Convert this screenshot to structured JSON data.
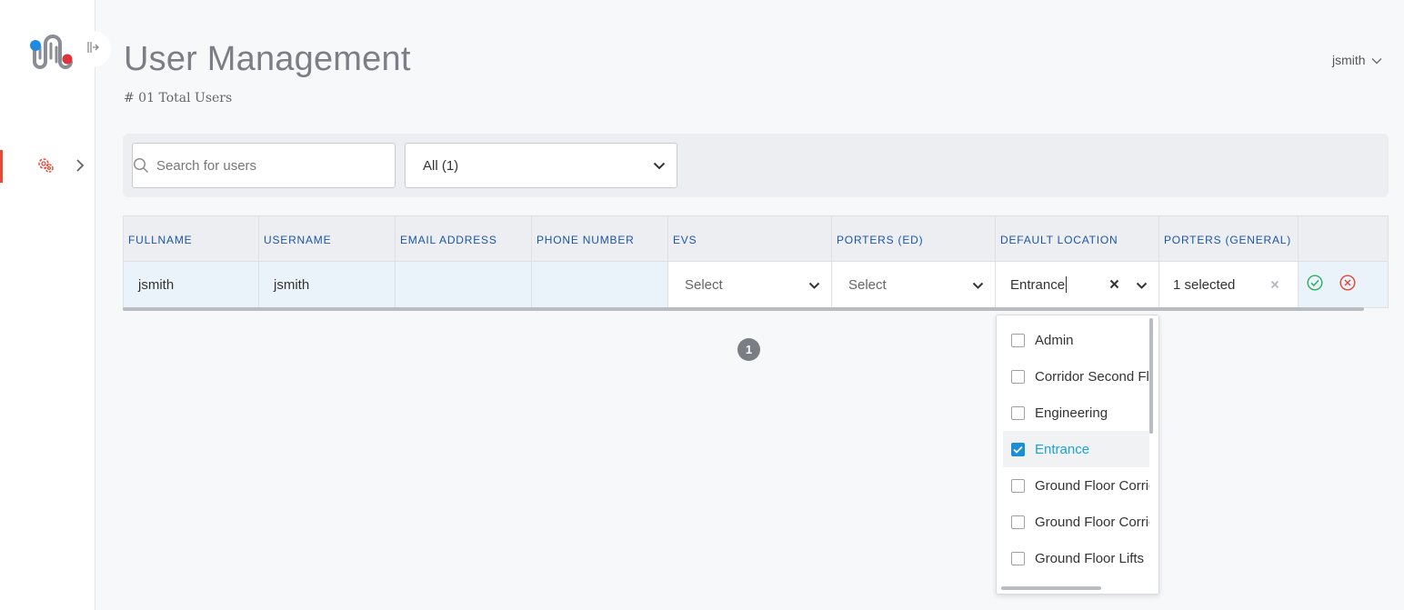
{
  "header": {
    "title": "User Management",
    "subtitle": "# 01 Total Users",
    "username": "jsmith"
  },
  "filters": {
    "search_placeholder": "Search for users",
    "role_filter_value": "All (1)"
  },
  "table": {
    "columns": [
      "FULLNAME",
      "USERNAME",
      "EMAIL ADDRESS",
      "PHONE NUMBER",
      "EVS",
      "PORTERS (ED)",
      "DEFAULT LOCATION",
      "PORTERS (GENERAL)"
    ],
    "row": {
      "fullname": "jsmith",
      "username": "jsmith",
      "email": "",
      "phone": "",
      "evs": "Select",
      "porters_ed": "Select",
      "default_location": "Entrance",
      "porters_general": "1 selected"
    }
  },
  "pagination": {
    "current_page": "1"
  },
  "location_dropdown": {
    "options": [
      {
        "label": "Admin",
        "checked": false
      },
      {
        "label": "Corridor Second Floor",
        "checked": false
      },
      {
        "label": "Engineering",
        "checked": false
      },
      {
        "label": "Entrance",
        "checked": true
      },
      {
        "label": "Ground Floor Corridor",
        "checked": false
      },
      {
        "label": "Ground Floor Corridor",
        "checked": false
      },
      {
        "label": "Ground Floor Lifts",
        "checked": false
      }
    ]
  },
  "colors": {
    "accent_red": "#e04b3a",
    "header_blue": "#1d55a4",
    "selected_blue": "#1aa3d6",
    "checkbox_blue": "#1a8fd6",
    "confirm_green": "#2eae5e",
    "cancel_red": "#e0443a",
    "logo_blue": "#1f8be0",
    "logo_red": "#e0323a"
  },
  "icons": {
    "logo": "brand-logo-icon",
    "collapse": "sidebar-collapse-icon",
    "nav": "users-gear-icon",
    "search": "search-icon",
    "chevron": "chevron-down-icon",
    "clear": "close-icon",
    "confirm": "check-circle-icon",
    "cancel": "x-circle-icon"
  }
}
